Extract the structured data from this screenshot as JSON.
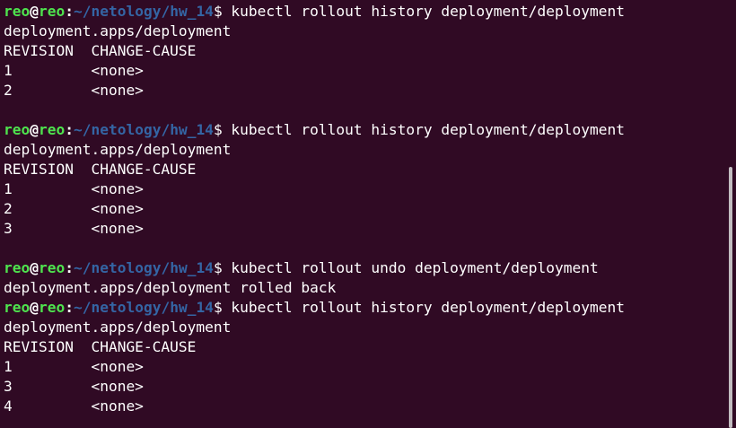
{
  "prompt": {
    "user": "reo",
    "at": "@",
    "host": "reo",
    "colon": ":",
    "path": "~/netology/hw_14",
    "dollar": "$"
  },
  "lines": [
    {
      "type": "prompt",
      "command": " kubectl rollout history deployment/deployment"
    },
    {
      "type": "output",
      "text": "deployment.apps/deployment"
    },
    {
      "type": "output",
      "text": "REVISION  CHANGE-CAUSE"
    },
    {
      "type": "output",
      "text": "1         <none>"
    },
    {
      "type": "output",
      "text": "2         <none>"
    },
    {
      "type": "output",
      "text": ""
    },
    {
      "type": "prompt",
      "command": " kubectl rollout history deployment/deployment"
    },
    {
      "type": "output",
      "text": "deployment.apps/deployment"
    },
    {
      "type": "output",
      "text": "REVISION  CHANGE-CAUSE"
    },
    {
      "type": "output",
      "text": "1         <none>"
    },
    {
      "type": "output",
      "text": "2         <none>"
    },
    {
      "type": "output",
      "text": "3         <none>"
    },
    {
      "type": "output",
      "text": ""
    },
    {
      "type": "prompt",
      "command": " kubectl rollout undo deployment/deployment"
    },
    {
      "type": "output",
      "text": "deployment.apps/deployment rolled back"
    },
    {
      "type": "prompt",
      "command": " kubectl rollout history deployment/deployment"
    },
    {
      "type": "output",
      "text": "deployment.apps/deployment"
    },
    {
      "type": "output",
      "text": "REVISION  CHANGE-CAUSE"
    },
    {
      "type": "output",
      "text": "1         <none>"
    },
    {
      "type": "output",
      "text": "3         <none>"
    },
    {
      "type": "output",
      "text": "4         <none>"
    }
  ],
  "colors": {
    "background": "#300a24",
    "user_host": "#4ee44e",
    "path": "#3465a4",
    "text": "#ffffff"
  }
}
